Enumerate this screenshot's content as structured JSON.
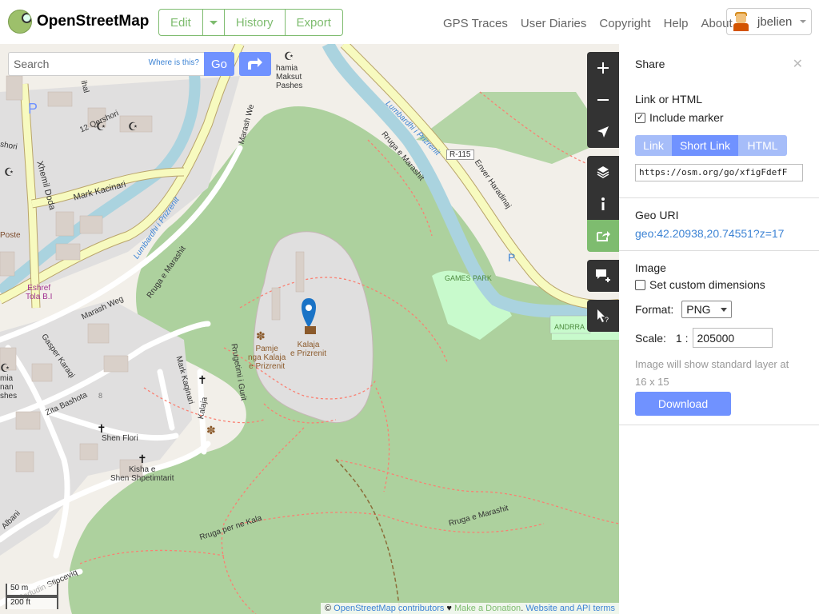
{
  "header": {
    "brand": "OpenStreetMap",
    "edit_label": "Edit",
    "history_label": "History",
    "export_label": "Export",
    "nav": [
      "GPS Traces",
      "User Diaries",
      "Copyright",
      "Help",
      "About"
    ],
    "username": "jbelien"
  },
  "search": {
    "placeholder": "Search",
    "where_label": "Where is this?",
    "go_label": "Go"
  },
  "map": {
    "labels": {
      "mark_kacinari": "Mark Kacinari",
      "xhemil_doda": "Xhemil Doda",
      "qershori": "12 Qershori",
      "marash_weg": "Marash Weg",
      "marash_we": "Marash We",
      "rruga_marashit_1": "Rruga e Marashit",
      "rruga_marashit_2": "Rruga e Marashit",
      "rruga_marashit_3": "Rruga e Marashit",
      "lumbardhi_1": "Lumbardhi i Prizrenit",
      "lumbardhi_2": "Lumbardhi i Prizrenit",
      "r115": "R-115",
      "enver": "Enver Haradinaj",
      "games_park": "GAMES PARK",
      "andrra": "ANDRRA",
      "xhamia_1": "hamia",
      "xhamia_2": "Maksut",
      "xhamia_3": "Pashes",
      "kalaja_1": "Kalaja",
      "kalaja_2": "e Prizrenit",
      "pamje_1": "Pamje",
      "pamje_2": "nga Kalaja",
      "pamje_3": "e Prizrenit",
      "eshref_1": "Eshref",
      "eshref_2": "Tola B.I",
      "poste": "Poste",
      "gasper": "Gasper Karaqi",
      "zita": "Zita Bashota",
      "shen_flori": "Shen Flori",
      "mark_kaqinari": "Mark Kaqinari",
      "kalaja_st": "Kalaja",
      "rrugetimi": "Rrugetimi i Gurit",
      "kisha_1": "Kisha e",
      "kisha_2": "Shen Shpetimtarit",
      "rruga_kala": "Rruga per ne Kala",
      "stipceviq": "Sadudin Stipceviq",
      "albani": "Albani",
      "hamia2": "mia",
      "nan": "nan",
      "shes": "shes",
      "ihal": "ihal",
      "shori": "shori",
      "house8": "8"
    },
    "scale_m": "50 m",
    "scale_ft": "200 ft",
    "attribution_prefix": "©",
    "attribution_contrib": "OpenStreetMap contributors",
    "attribution_heart": "♥",
    "attribution_donate": "Make a Donation",
    "attribution_terms": "Website and API terms"
  },
  "share_panel": {
    "title": "Share",
    "link_heading": "Link or HTML",
    "include_marker": "Include marker",
    "tabs": [
      "Link",
      "Short Link",
      "HTML"
    ],
    "active_tab": "Short Link",
    "url": "https://osm.org/go/xfigFdefF",
    "geo_heading": "Geo URI",
    "geo_uri": "geo:42.20938,20.74551?z=17",
    "image_heading": "Image",
    "custom_dims": "Set custom dimensions",
    "format_label": "Format:",
    "format_value": "PNG",
    "scale_label": "Scale:",
    "scale_prefix": "1 :",
    "scale_value": "205000",
    "note": "Image will show standard layer at 16 x 15",
    "download_label": "Download"
  },
  "colors": {
    "accent_green": "#7ebc6f",
    "button_blue": "#7092ff",
    "forest": "#add19e",
    "river": "#aad3df",
    "road_yellow": "#f7fabf"
  }
}
